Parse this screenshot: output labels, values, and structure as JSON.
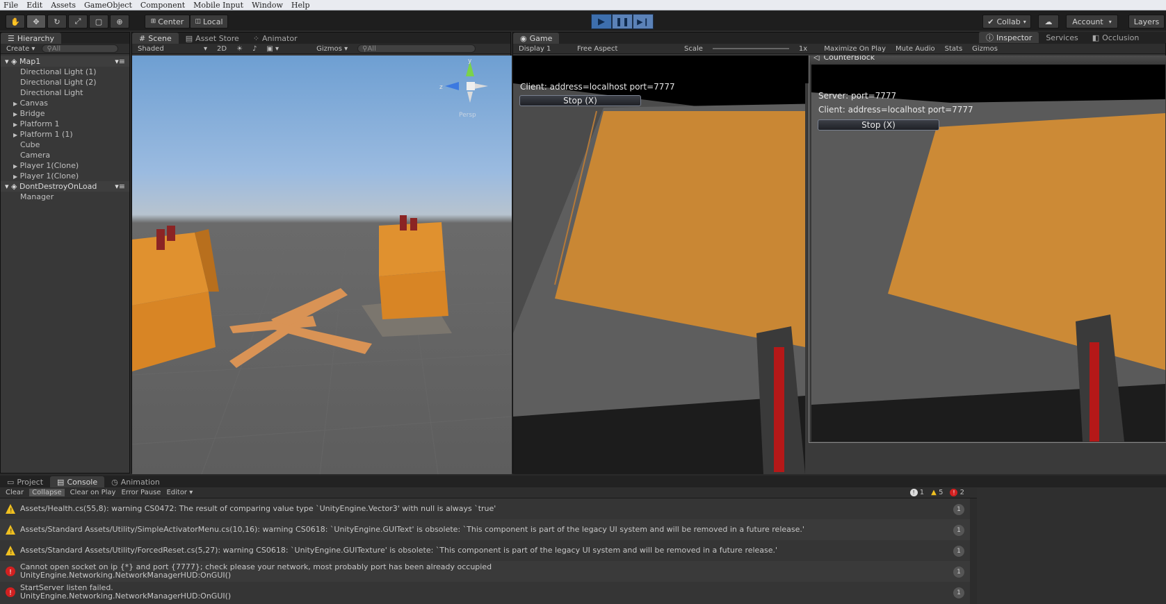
{
  "menu": [
    "File",
    "Edit",
    "Assets",
    "GameObject",
    "Component",
    "Mobile Input",
    "Window",
    "Help"
  ],
  "toolbar": {
    "pivot_label": "Center",
    "space_label": "Local",
    "collab_label": "Collab",
    "account_label": "Account",
    "layers_label": "Layers"
  },
  "hierarchy": {
    "tab": "Hierarchy",
    "create_label": "Create",
    "search_placeholder": "All",
    "scene_name": "Map1",
    "items": [
      "Directional Light (1)",
      "Directional Light (2)",
      "Directional Light",
      "Canvas",
      "Bridge",
      "Platform 1",
      "Platform 1 (1)",
      "Cube",
      "Camera",
      "Player 1(Clone)",
      "Player 1(Clone)"
    ],
    "ddol_scene": "DontDestroyOnLoad",
    "ddol_items": [
      "Manager"
    ]
  },
  "scene": {
    "tabs": [
      "Scene",
      "Asset Store",
      "Animator"
    ],
    "shading": "Shaded",
    "mode2d": "2D",
    "gizmos": "Gizmos",
    "search_placeholder": "All",
    "persp_label": "Persp",
    "axis_y": "y",
    "axis_z": "z"
  },
  "game": {
    "tab": "Game",
    "display": "Display 1",
    "aspect": "Free Aspect",
    "scale_label": "Scale",
    "scale_value": "1x",
    "options": [
      "Maximize On Play",
      "Mute Audio",
      "Stats",
      "Gizmos"
    ],
    "client_text": "Client: address=localhost port=7777",
    "stop_label": "Stop (X)"
  },
  "popup": {
    "title": "CounterBlock",
    "server_text": "Server: port=7777",
    "client_text": "Client: address=localhost port=7777",
    "stop_label": "Stop (X)"
  },
  "inspector": {
    "tabs": [
      "Inspector",
      "Services",
      "Occlusion"
    ]
  },
  "console": {
    "tabs": [
      "Project",
      "Console",
      "Animation"
    ],
    "toolbar": [
      "Clear",
      "Collapse",
      "Clear on Play",
      "Error Pause",
      "Editor"
    ],
    "counts": {
      "info": "1",
      "warn": "5",
      "error": "2"
    },
    "entries": [
      {
        "type": "warning",
        "line1": "Assets/Health.cs(55,8): warning CS0472: The result of comparing value type `UnityEngine.Vector3' with null is always `true'",
        "line2": "",
        "count": "1"
      },
      {
        "type": "warning",
        "line1": "Assets/Standard Assets/Utility/SimpleActivatorMenu.cs(10,16): warning CS0618: `UnityEngine.GUIText' is obsolete: `This component is part of the legacy UI system and will be removed in a future release.'",
        "line2": "",
        "count": "1"
      },
      {
        "type": "warning",
        "line1": "Assets/Standard Assets/Utility/ForcedReset.cs(5,27): warning CS0618: `UnityEngine.GUITexture' is obsolete: `This component is part of the legacy UI system and will be removed in a future release.'",
        "line2": "",
        "count": "1"
      },
      {
        "type": "error",
        "line1": "Cannot open socket on ip {*} and port {7777}; check please your network, most probably port has been already occupied",
        "line2": "UnityEngine.Networking.NetworkManagerHUD:OnGUI()",
        "count": "1"
      },
      {
        "type": "error",
        "line1": "StartServer listen failed.",
        "line2": "UnityEngine.Networking.NetworkManagerHUD:OnGUI()",
        "count": "1"
      }
    ]
  },
  "colors": {
    "play_active": "#3d6fae",
    "orange": "#d98a3a",
    "warning": "#f0c020",
    "error": "#d22020"
  }
}
